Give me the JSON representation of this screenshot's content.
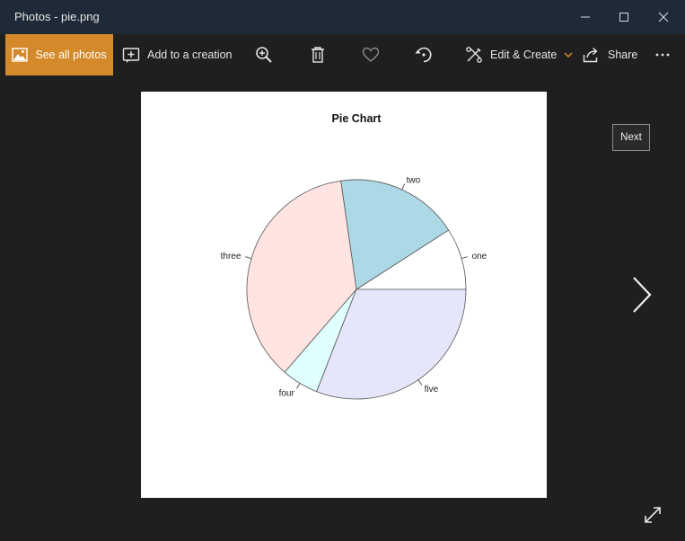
{
  "window": {
    "title": "Photos - pie.png",
    "controls": [
      "minimize",
      "maximize",
      "close"
    ]
  },
  "toolbar": {
    "see_all_photos": "See all photos",
    "add_to_creation": "Add to a creation",
    "edit_create": "Edit & Create",
    "share": "Share",
    "icons": [
      "zoom-in-icon",
      "delete-icon",
      "favorite-icon",
      "rotate-icon",
      "more-icon"
    ]
  },
  "viewer": {
    "next_tooltip": "Next"
  },
  "colors": {
    "accent": "#d48a2a",
    "titlebar": "#1f2a38",
    "background": "#1f1f1f"
  },
  "chart_data": {
    "type": "pie",
    "title": "Pie Chart",
    "categories": [
      "one",
      "two",
      "three",
      "four",
      "five"
    ],
    "values": [
      1,
      2,
      4,
      0.6,
      3.4
    ],
    "colors": [
      "#ffffff",
      "#add8e6",
      "#ffe4e1",
      "#e0ffff",
      "#e6e6fa"
    ],
    "start_angle_deg": 0,
    "direction": "counterclockwise"
  }
}
